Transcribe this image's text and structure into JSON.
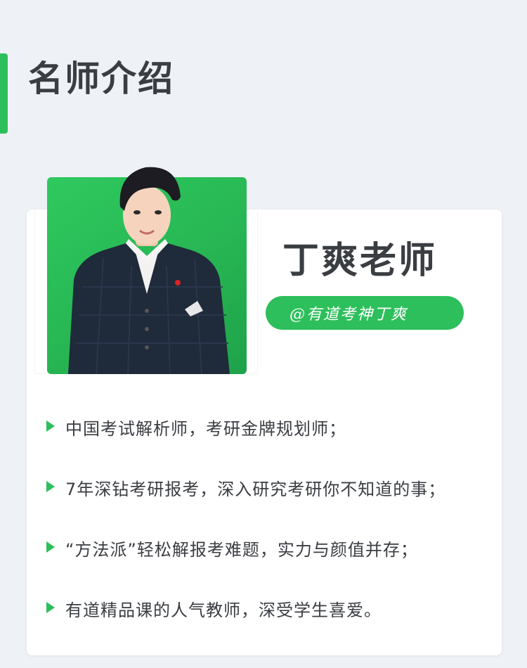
{
  "header": {
    "title": "名师介绍"
  },
  "teacher": {
    "name": "丁爽老师",
    "handle": "@有道考神丁爽"
  },
  "bullets": [
    "中国考试解析师，考研金牌规划师；",
    "7年深钻考研报考，深入研究考研你不知道的事；",
    "“方法派”轻松解报考难题，实力与颜值并存；",
    "有道精品课的人气教师，深受学生喜爱。"
  ],
  "colors": {
    "accent": "#2dbf5b",
    "background": "#eef1f5",
    "text": "#3a3d42"
  }
}
